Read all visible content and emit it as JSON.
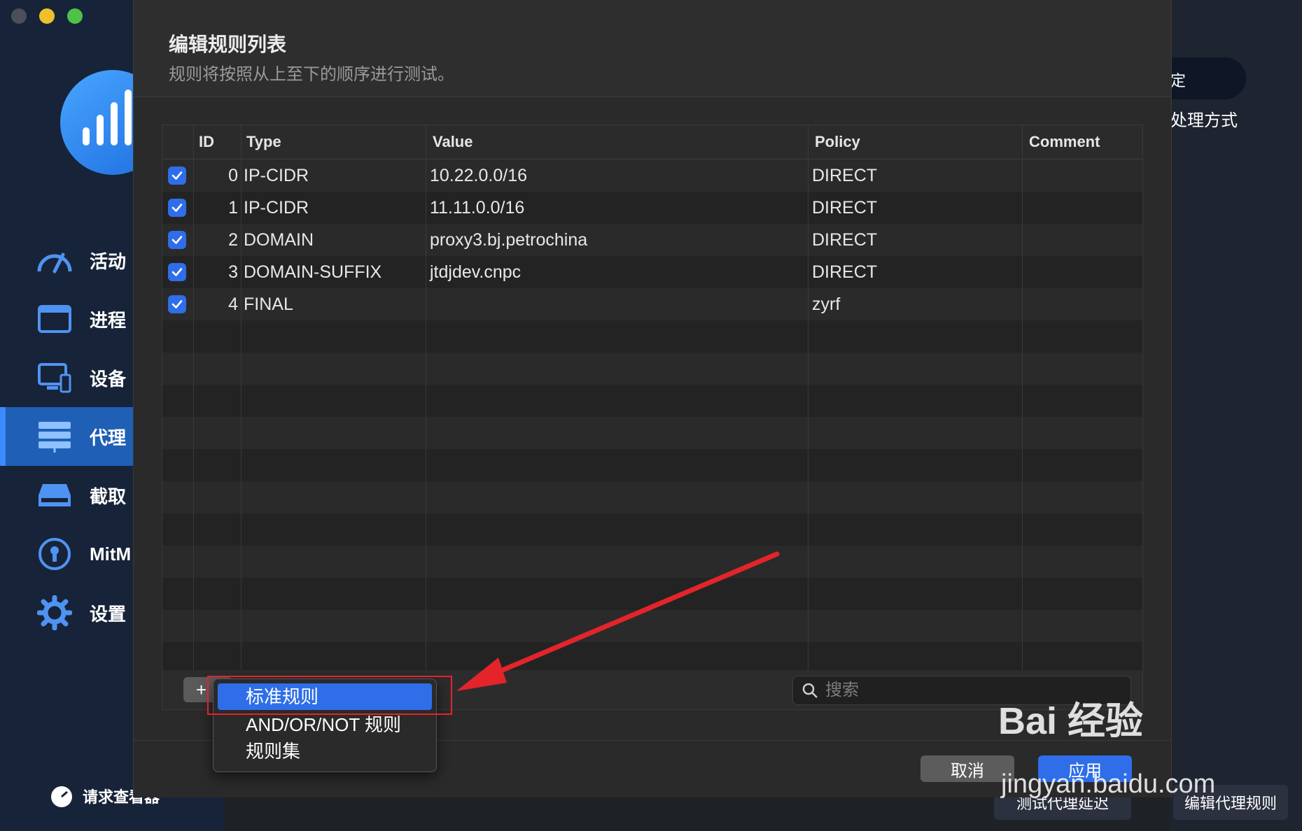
{
  "sidebar": {
    "items": [
      {
        "label": "活动",
        "icon": "speedometer-icon"
      },
      {
        "label": "进程",
        "icon": "window-icon"
      },
      {
        "label": "设备",
        "icon": "monitor-icon"
      },
      {
        "label": "代理",
        "icon": "server-icon",
        "active": true
      },
      {
        "label": "截取",
        "icon": "drive-icon"
      },
      {
        "label": "MitM",
        "icon": "keyhole-icon"
      },
      {
        "label": "设置",
        "icon": "gear-icon"
      }
    ],
    "request_viewer": "请求查看器"
  },
  "background": {
    "pill_label": "定",
    "side_text": "处理方式",
    "test_latency_button": "测试代理延迟",
    "edit_rules_button": "编辑代理规则"
  },
  "dialog": {
    "title": "编辑规则列表",
    "subtitle": "规则将按照从上至下的顺序进行测试。",
    "columns": [
      "ID",
      "Type",
      "Value",
      "Policy",
      "Comment"
    ],
    "rows": [
      {
        "checked": true,
        "id": "0",
        "type": "IP-CIDR",
        "value": "10.22.0.0/16",
        "policy": "DIRECT",
        "comment": ""
      },
      {
        "checked": true,
        "id": "1",
        "type": "IP-CIDR",
        "value": "11.11.0.0/16",
        "policy": "DIRECT",
        "comment": ""
      },
      {
        "checked": true,
        "id": "2",
        "type": "DOMAIN",
        "value": "proxy3.bj.petrochina",
        "policy": "DIRECT",
        "comment": ""
      },
      {
        "checked": true,
        "id": "3",
        "type": "DOMAIN-SUFFIX",
        "value": "jtdjdev.cnpc",
        "policy": "DIRECT",
        "comment": ""
      },
      {
        "checked": true,
        "id": "4",
        "type": "FINAL",
        "value": "",
        "policy": "zyrf",
        "comment": ""
      }
    ],
    "add_button": "+",
    "search_placeholder": "搜索",
    "cancel_button": "取消",
    "apply_button": "应用"
  },
  "add_menu": {
    "items": [
      "标准规则",
      "AND/OR/NOT 规则",
      "规则集"
    ],
    "selected_index": 0
  },
  "watermark": {
    "brand": "Bai 经验",
    "url": "jingyan.baidu.com"
  },
  "colors": {
    "accent": "#2f6ee8",
    "sidebar": "#172338",
    "highlight": "#e3242b"
  }
}
